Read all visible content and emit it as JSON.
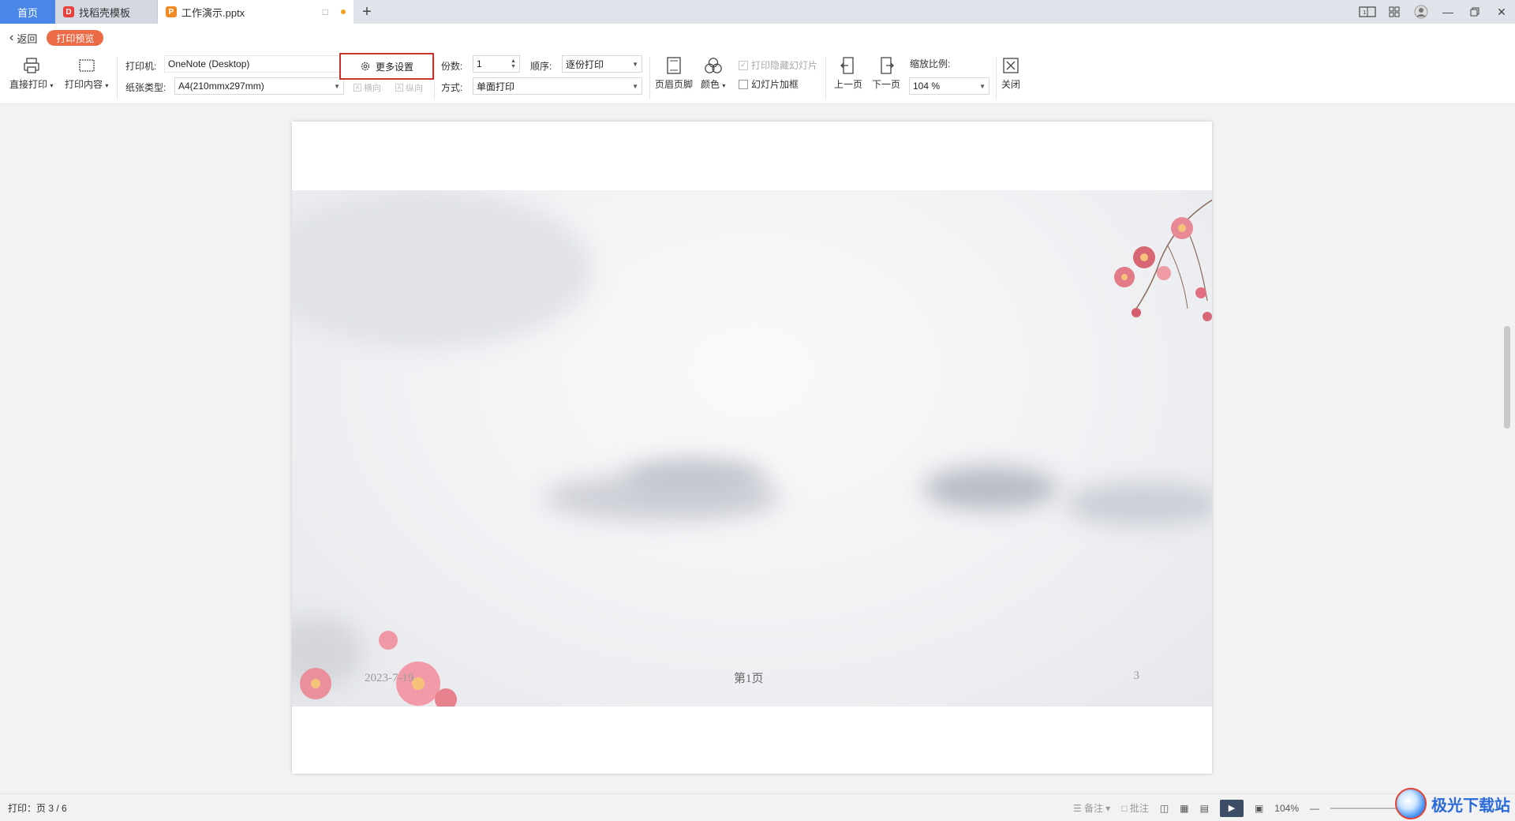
{
  "titlebar": {
    "tabs": [
      {
        "label": "首页"
      },
      {
        "label": "找稻壳模板"
      },
      {
        "label": "工作演示.pptx"
      }
    ],
    "new_tab": "+"
  },
  "subbar": {
    "back_label": "返回",
    "mode_label": "打印预览"
  },
  "toolbar": {
    "direct_print": "直接打印",
    "print_content": "打印内容",
    "printer_label": "打印机:",
    "printer_value": "OneNote (Desktop)",
    "paper_label": "纸张类型:",
    "paper_value": "A4(210mmx297mm)",
    "more_settings": "更多设置",
    "landscape": "横向",
    "portrait": "纵向",
    "copies_label": "份数:",
    "copies_value": "1",
    "order_label": "顺序:",
    "order_value": "逐份打印",
    "mode_label": "方式:",
    "mode_value": "单面打印",
    "header_footer": "页眉页脚",
    "color": "颜色",
    "print_hidden": "打印隐藏幻灯片",
    "slide_frame": "幻灯片加框",
    "prev_page": "上一页",
    "next_page": "下一页",
    "zoom_label": "缩放比例:",
    "zoom_value": "104 %",
    "close": "关闭"
  },
  "slide": {
    "date": "2023-7-19",
    "page_label": "第1页",
    "number": "3"
  },
  "statusbar": {
    "print_info": "打印：页 3 / 6",
    "notes": "备注",
    "comments": "批注",
    "zoom": "104%"
  },
  "watermark": {
    "text": "极光下载站"
  },
  "colors": {
    "home_tab": "#4a86e8",
    "preview_pill": "#ec6b47",
    "highlight_border": "#c9302c"
  }
}
